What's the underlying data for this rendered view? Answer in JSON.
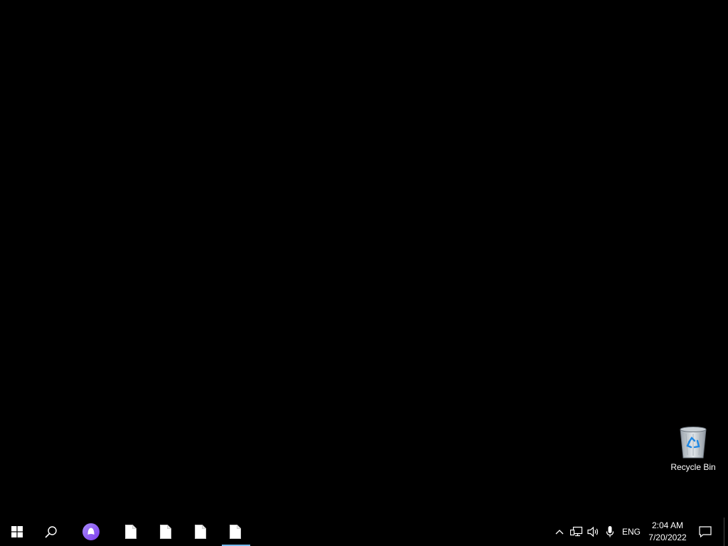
{
  "desktop": {
    "background_color": "#000000",
    "icons": [
      {
        "label": "Recycle Bin",
        "icon": "recycle-bin-icon"
      }
    ]
  },
  "taskbar": {
    "background_color": "#000000",
    "start_icon": "windows-logo-icon",
    "search_icon": "search-icon",
    "assistant_icon": "assistant-icon",
    "assistant_color": "#8b5cf6",
    "pinned_apps": [
      {
        "icon": "document-icon",
        "active": false
      },
      {
        "icon": "document-icon",
        "active": false
      },
      {
        "icon": "document-icon",
        "active": false
      },
      {
        "icon": "document-icon",
        "active": true
      }
    ],
    "active_indicator_color": "#76b9ed"
  },
  "tray": {
    "chevron_icon": "chevron-up-icon",
    "network_icon": "network-icon",
    "volume_icon": "volume-icon",
    "mic_icon": "microphone-icon",
    "language": "ENG",
    "time": "2:04 AM",
    "date": "7/20/2022",
    "notifications_icon": "action-center-icon"
  }
}
